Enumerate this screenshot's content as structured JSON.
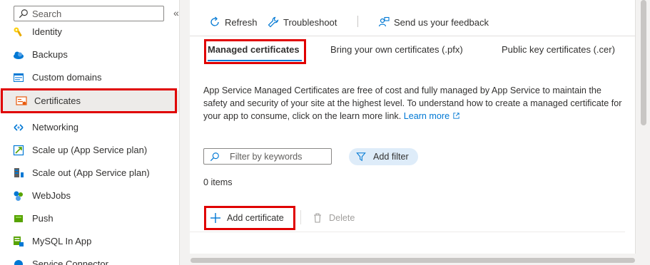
{
  "sidebar": {
    "search_placeholder": "Search",
    "collapse_glyph": "«",
    "items": [
      {
        "label": "Identity",
        "icon": "key-icon"
      },
      {
        "label": "Backups",
        "icon": "cloud-icon"
      },
      {
        "label": "Custom domains",
        "icon": "domain-icon"
      },
      {
        "label": "Certificates",
        "icon": "certificate-icon",
        "selected": true
      },
      {
        "label": "Networking",
        "icon": "network-icon"
      },
      {
        "label": "Scale up (App Service plan)",
        "icon": "scale-up-icon"
      },
      {
        "label": "Scale out (App Service plan)",
        "icon": "scale-out-icon"
      },
      {
        "label": "WebJobs",
        "icon": "webjobs-icon"
      },
      {
        "label": "Push",
        "icon": "push-icon"
      },
      {
        "label": "MySQL In App",
        "icon": "mysql-icon"
      },
      {
        "label": "Service Connector",
        "icon": "connector-icon"
      }
    ]
  },
  "toolbar": {
    "refresh_label": "Refresh",
    "troubleshoot_label": "Troubleshoot",
    "feedback_label": "Send us your feedback"
  },
  "tabs": [
    {
      "label": "Managed certificates",
      "active": true
    },
    {
      "label": "Bring your own certificates (.pfx)"
    },
    {
      "label": "Public key certificates (.cer)"
    }
  ],
  "description": {
    "text": "App Service Managed Certificates are free of cost and fully managed by App Service to maintain the safety and security of your site at the highest level. To understand how to create a managed certificate for your app to consume, click on the learn more link.",
    "link_text": "Learn more"
  },
  "filter": {
    "placeholder": "Filter by keywords",
    "add_filter_label": "Add filter"
  },
  "item_count": "0 items",
  "actions": {
    "add_label": "Add certificate",
    "delete_label": "Delete"
  },
  "colors": {
    "accent": "#0078d4",
    "highlight": "#e00000",
    "selected_bg": "#edebe9",
    "pill_bg": "#deecf9"
  }
}
